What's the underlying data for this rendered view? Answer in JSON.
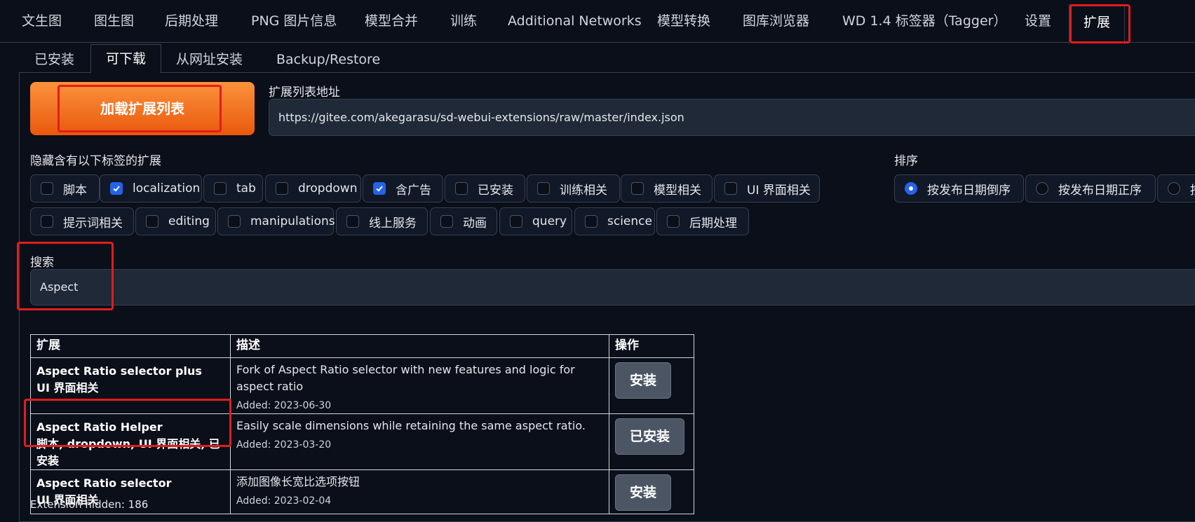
{
  "top_tabs": [
    "文生图",
    "图生图",
    "后期处理",
    "PNG 图片信息",
    "模型合并",
    "训练",
    "Additional Networks",
    "模型转换",
    "图库浏览器",
    "WD 1.4 标签器（Tagger）",
    "设置",
    "扩展"
  ],
  "sub_tabs": [
    "已安装",
    "可下载",
    "从网址安装",
    "Backup/Restore"
  ],
  "load_button": "加载扩展列表",
  "url_label": "扩展列表地址",
  "url_value": "https://gitee.com/akegarasu/sd-webui-extensions/raw/master/index.json",
  "hide_label": "隐藏含有以下标签的扩展",
  "tags": [
    {
      "label": "脚本",
      "checked": false
    },
    {
      "label": "localization",
      "checked": true
    },
    {
      "label": "tab",
      "checked": false
    },
    {
      "label": "dropdown",
      "checked": false
    },
    {
      "label": "含广告",
      "checked": true
    },
    {
      "label": "已安装",
      "checked": false
    },
    {
      "label": "训练相关",
      "checked": false
    },
    {
      "label": "模型相关",
      "checked": false
    },
    {
      "label": "UI 界面相关",
      "checked": false
    },
    {
      "label": "提示词相关",
      "checked": false
    },
    {
      "label": "editing",
      "checked": false
    },
    {
      "label": "manipulations",
      "checked": false
    },
    {
      "label": "线上服务",
      "checked": false
    },
    {
      "label": "动画",
      "checked": false
    },
    {
      "label": "query",
      "checked": false
    },
    {
      "label": "science",
      "checked": false
    },
    {
      "label": "后期处理",
      "checked": false
    }
  ],
  "sort_label": "排序",
  "sort_options": [
    {
      "label": "按发布日期倒序",
      "selected": true
    },
    {
      "label": "按发布日期正序",
      "selected": false
    },
    {
      "label": "按",
      "selected": false
    }
  ],
  "search_label": "搜索",
  "search_value": "Aspect",
  "table": {
    "headers": [
      "扩展",
      "描述",
      "操作"
    ],
    "rows": [
      {
        "name": "Aspect Ratio selector plus",
        "tags": "UI 界面相关",
        "desc": "Fork of Aspect Ratio selector with new features and logic for aspect ratio",
        "added": "Added: 2023-06-30",
        "action": "安装"
      },
      {
        "name": "Aspect Ratio Helper",
        "tags": "脚本, dropdown, UI 界面相关, 已安装",
        "desc": "Easily scale dimensions while retaining the same aspect ratio.",
        "added": "Added: 2023-03-20",
        "action": "已安装"
      },
      {
        "name": "Aspect Ratio selector",
        "tags": "UI 界面相关",
        "desc": "添加图像长宽比选项按钮",
        "added": "Added: 2023-02-04",
        "action": "安装"
      }
    ]
  },
  "hidden_count": "Extension hidden: 186",
  "colors": {
    "accent": "#ea580c",
    "highlight": "#e11d1d",
    "checkbox": "#2563eb",
    "background": "#0b0f19"
  }
}
